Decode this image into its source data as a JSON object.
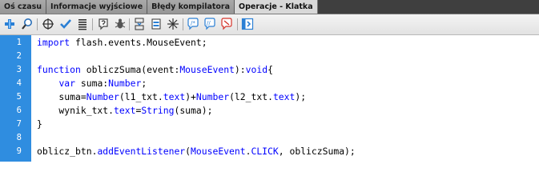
{
  "tabs": [
    {
      "label": "Oś czasu",
      "active": false
    },
    {
      "label": "Informacje wyjściowe",
      "active": false
    },
    {
      "label": "Błędy kompilatora",
      "active": false
    },
    {
      "label": "Operacje - Klatka",
      "active": true
    }
  ],
  "toolbar": {
    "icons": [
      "add-statement-icon",
      "find-icon",
      "insert-target-path-icon",
      "check-syntax-icon",
      "auto-format-icon",
      "code-hint-icon",
      "debug-options-icon",
      "collapse-between-braces-icon",
      "collapse-selection-icon",
      "expand-all-icon",
      "apply-block-comment-icon",
      "apply-line-comment-icon",
      "remove-comment-icon",
      "show-hide-toolbox-icon"
    ]
  },
  "colors": {
    "gutter": "#2f8de0",
    "keyword": "#0000ff",
    "text": "#000000"
  },
  "code": {
    "lines": [
      {
        "num": "1",
        "segments": [
          {
            "t": "kw",
            "v": "import"
          },
          {
            "t": "cm",
            "v": " flash.events.MouseEvent;"
          }
        ]
      },
      {
        "num": "2",
        "segments": []
      },
      {
        "num": "3",
        "segments": [
          {
            "t": "kw",
            "v": "function"
          },
          {
            "t": "cm",
            "v": " obliczSuma(event:"
          },
          {
            "t": "ty",
            "v": "MouseEvent"
          },
          {
            "t": "cm",
            "v": "):"
          },
          {
            "t": "kw",
            "v": "void"
          },
          {
            "t": "cm",
            "v": "{"
          }
        ]
      },
      {
        "num": "4",
        "segments": [
          {
            "t": "cm",
            "v": "    "
          },
          {
            "t": "kw",
            "v": "var"
          },
          {
            "t": "cm",
            "v": " suma:"
          },
          {
            "t": "ty",
            "v": "Number"
          },
          {
            "t": "cm",
            "v": ";"
          }
        ]
      },
      {
        "num": "5",
        "segments": [
          {
            "t": "cm",
            "v": "    suma="
          },
          {
            "t": "ty",
            "v": "Number"
          },
          {
            "t": "cm",
            "v": "(l1_txt."
          },
          {
            "t": "ty",
            "v": "text"
          },
          {
            "t": "cm",
            "v": ")+"
          },
          {
            "t": "ty",
            "v": "Number"
          },
          {
            "t": "cm",
            "v": "(l2_txt."
          },
          {
            "t": "ty",
            "v": "text"
          },
          {
            "t": "cm",
            "v": ");"
          }
        ]
      },
      {
        "num": "6",
        "segments": [
          {
            "t": "cm",
            "v": "    wynik_txt."
          },
          {
            "t": "ty",
            "v": "text"
          },
          {
            "t": "cm",
            "v": "="
          },
          {
            "t": "ty",
            "v": "String"
          },
          {
            "t": "cm",
            "v": "(suma);"
          }
        ]
      },
      {
        "num": "7",
        "segments": [
          {
            "t": "cm",
            "v": "}"
          }
        ]
      },
      {
        "num": "8",
        "segments": []
      },
      {
        "num": "9",
        "segments": [
          {
            "t": "cm",
            "v": "oblicz_btn."
          },
          {
            "t": "ty",
            "v": "addEventListener"
          },
          {
            "t": "cm",
            "v": "("
          },
          {
            "t": "ty",
            "v": "MouseEvent"
          },
          {
            "t": "cm",
            "v": "."
          },
          {
            "t": "ty",
            "v": "CLICK"
          },
          {
            "t": "cm",
            "v": ", obliczSuma);"
          }
        ]
      }
    ]
  }
}
